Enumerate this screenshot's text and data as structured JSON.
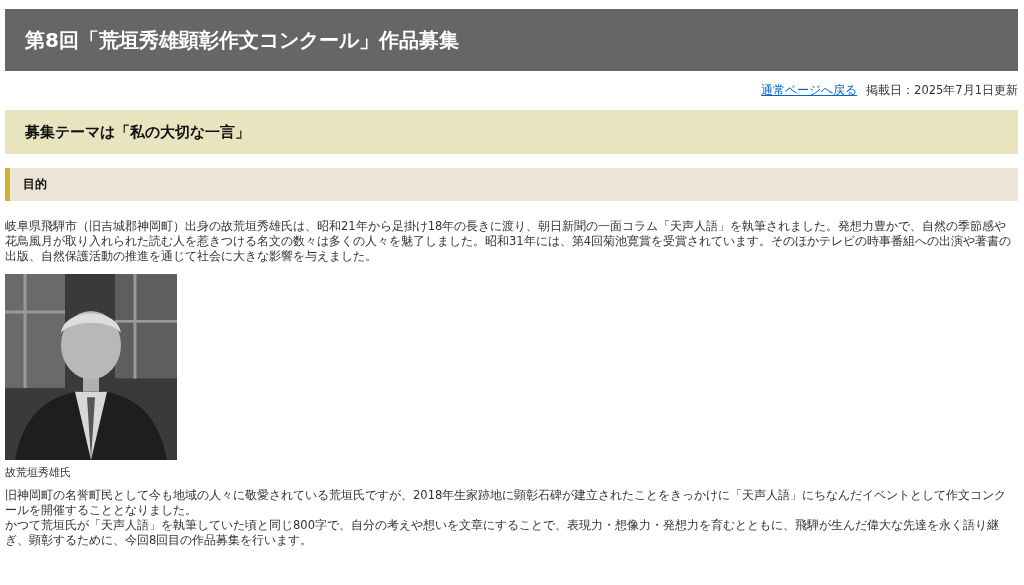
{
  "page_title": "第8回「荒垣秀雄顕彰作文コンクール」作品募集",
  "meta": {
    "back_link": "通常ページへ戻る",
    "posted": "掲載日：2025年7月1日更新"
  },
  "theme_heading": "募集テーマは「私の大切な一言」",
  "section_heading": "目的",
  "intro": "岐阜県飛騨市（旧吉城郡神岡町）出身の故荒垣秀雄氏は、昭和21年から足掛け18年の長きに渡り、朝日新聞の一面コラム「天声人語」を執筆されました。発想力豊かで、自然の季節感や花鳥風月が取り入れられた読む人を惹きつける名文の数々は多くの人々を魅了しました。昭和31年には、第4回菊池寛賞を受賞されています。そのほかテレビの時事番組への出演や著書の出版、自然保護活動の推進を通じて社会に大きな影響を与えました。",
  "photo": {
    "kind": "picture",
    "caption": "故荒垣秀雄氏"
  },
  "body": [
    "旧神岡町の名誉町民として今も地域の人々に敬愛されている荒垣氏ですが、2018年生家跡地に顕彰石碑が建立されたことをきっかけに「天声人語」にちなんだイベントとして作文コンクールを開催することとなりました。",
    "かつて荒垣氏が「天声人語」を執筆していた頃と同じ800字で、自分の考えや想いを文章にすることで、表現力・想像力・発想力を育むとともに、飛騨が生んだ偉大な先達を永く語り継ぎ、顕彰するために、今回8回目の作品募集を行います。"
  ]
}
